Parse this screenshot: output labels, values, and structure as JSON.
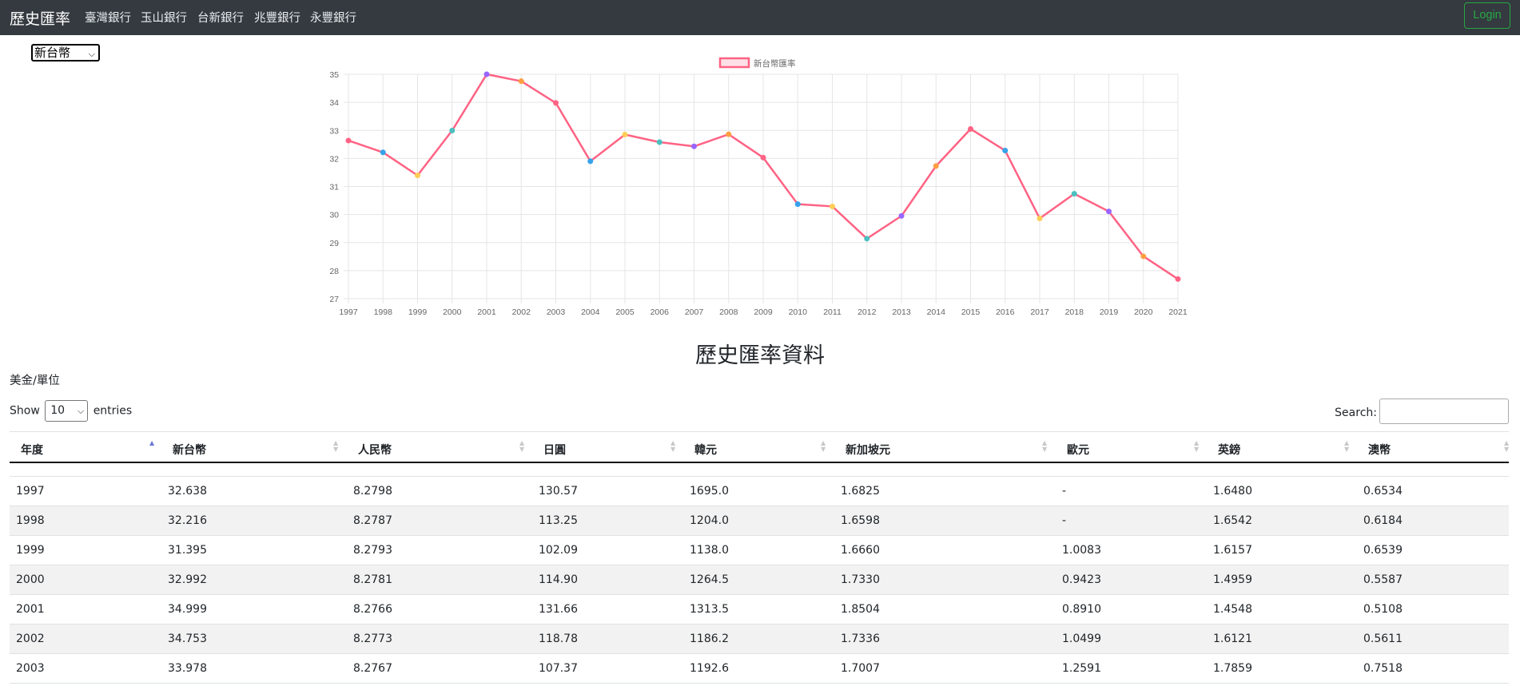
{
  "navbar": {
    "brand": "歷史匯率",
    "links": [
      "臺灣銀行",
      "玉山銀行",
      "台新銀行",
      "兆豐銀行",
      "永豐銀行"
    ],
    "login_label": "Login"
  },
  "currency_select": {
    "selected": "新台幣"
  },
  "chart_data": {
    "type": "line",
    "categories": [
      "1997",
      "1998",
      "1999",
      "2000",
      "2001",
      "2002",
      "2003",
      "2004",
      "2005",
      "2006",
      "2007",
      "2008",
      "2009",
      "2010",
      "2011",
      "2012",
      "2013",
      "2014",
      "2015",
      "2016",
      "2017",
      "2018",
      "2019",
      "2020",
      "2021"
    ],
    "series": [
      {
        "name": "新台幣匯率",
        "values": [
          32.638,
          32.216,
          31.395,
          32.992,
          34.999,
          34.753,
          33.978,
          31.9,
          32.85,
          32.58,
          32.43,
          32.86,
          32.03,
          30.37,
          30.29,
          29.14,
          29.95,
          31.73,
          33.05,
          32.28,
          29.86,
          30.74,
          30.11,
          28.51,
          27.7
        ],
        "line_color": "#ff6384",
        "point_colors": [
          "#ff6384",
          "#36a2eb",
          "#ffcd56",
          "#4bc0c0",
          "#9966ff",
          "#ff9f40",
          "#ff6384",
          "#36a2eb",
          "#ffcd56",
          "#4bc0c0",
          "#9966ff",
          "#ff9f40",
          "#ff6384",
          "#36a2eb",
          "#ffcd56",
          "#4bc0c0",
          "#9966ff",
          "#ff9f40",
          "#ff6384",
          "#36a2eb",
          "#ffcd56",
          "#4bc0c0",
          "#9966ff",
          "#ff9f40",
          "#ff6384"
        ]
      }
    ],
    "yticks": [
      27,
      28,
      29,
      30,
      31,
      32,
      33,
      34,
      35
    ],
    "ylim": [
      27,
      35
    ],
    "grid": true,
    "legend": "top-center"
  },
  "section_title": "歷史匯率資料",
  "unit_label": "美金/單位",
  "table_controls": {
    "show_label": "Show",
    "entries_value": "10",
    "entries_label": "entries",
    "search_label": "Search:"
  },
  "table": {
    "headers": [
      "年度",
      "新台幣",
      "人民幣",
      "日圓",
      "韓元",
      "新加坡元",
      "歐元",
      "英鎊",
      "澳幣"
    ],
    "rows": [
      [
        "1997",
        "32.638",
        "8.2798",
        "130.57",
        "1695.0",
        "1.6825",
        "-",
        "1.6480",
        "0.6534"
      ],
      [
        "1998",
        "32.216",
        "8.2787",
        "113.25",
        "1204.0",
        "1.6598",
        "-",
        "1.6542",
        "0.6184"
      ],
      [
        "1999",
        "31.395",
        "8.2793",
        "102.09",
        "1138.0",
        "1.6660",
        "1.0083",
        "1.6157",
        "0.6539"
      ],
      [
        "2000",
        "32.992",
        "8.2781",
        "114.90",
        "1264.5",
        "1.7330",
        "0.9423",
        "1.4959",
        "0.5587"
      ],
      [
        "2001",
        "34.999",
        "8.2766",
        "131.66",
        "1313.5",
        "1.8504",
        "0.8910",
        "1.4548",
        "0.5108"
      ],
      [
        "2002",
        "34.753",
        "8.2773",
        "118.78",
        "1186.2",
        "1.7336",
        "1.0499",
        "1.6121",
        "0.5611"
      ],
      [
        "2003",
        "33.978",
        "8.2767",
        "107.37",
        "1192.6",
        "1.7007",
        "1.2591",
        "1.7859",
        "0.7518"
      ]
    ]
  }
}
